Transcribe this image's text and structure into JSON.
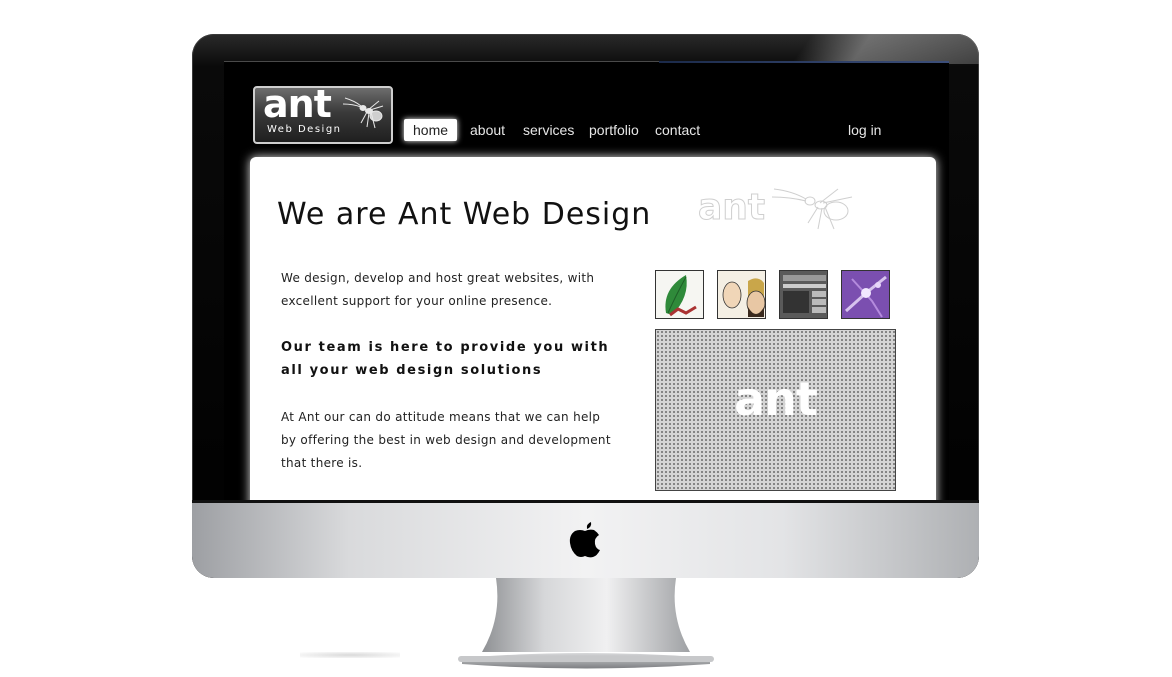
{
  "logo": {
    "word": "ant",
    "subtitle": "Web Design"
  },
  "nav": {
    "items": [
      "home",
      "about",
      "services",
      "portfolio",
      "contact"
    ],
    "active": "home",
    "login": "log in"
  },
  "main": {
    "headline": "We are Ant Web Design",
    "ghost_logo_word": "ant",
    "intro": "We design, develop and host great websites, with excellent support for your online presence.",
    "team": "Our team is here to provide you with all your web design solutions",
    "attitude": "At Ant our can do attitude means that we can help by offering the best in web design and development that there is.",
    "feature_word": "ant",
    "thumbnails": [
      "leaf-thumbnail",
      "person-thumbnail",
      "website-thumbnail",
      "purple-flower-thumbnail"
    ]
  },
  "colors": {
    "screen_bg": "#000000",
    "content_bg": "#ffffff",
    "nav_text": "#e6e6e6",
    "bezel": "#000000",
    "chin": "#e0e1e3"
  },
  "icons": {
    "brand": "apple-logo-icon",
    "mascot": "ant-icon"
  }
}
